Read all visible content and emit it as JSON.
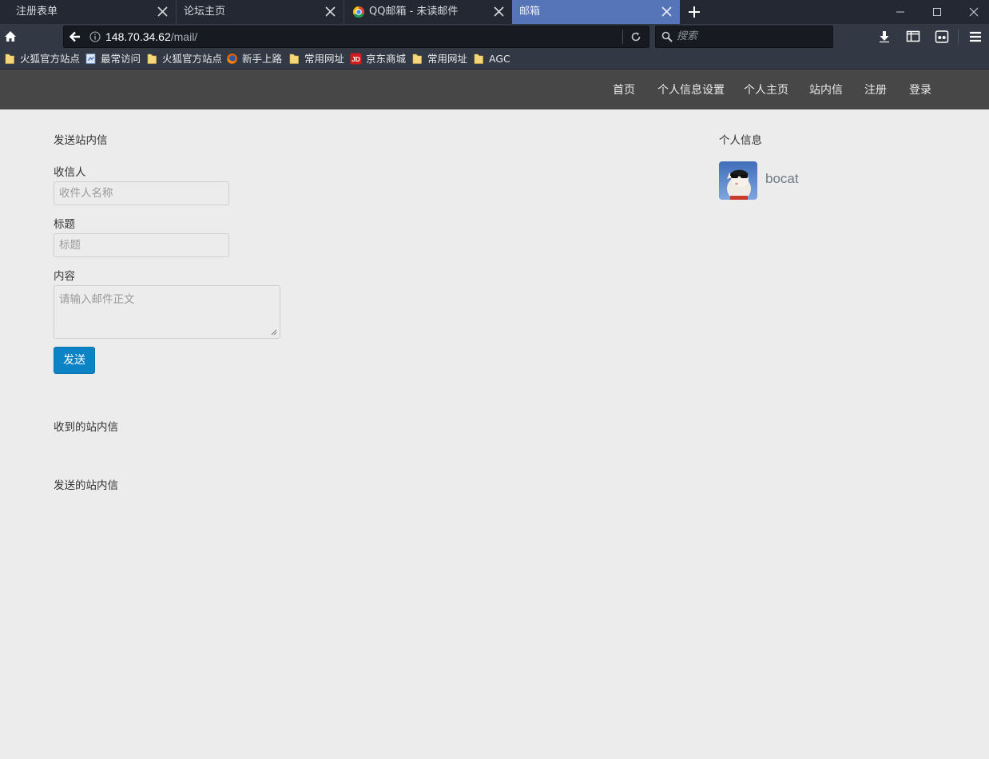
{
  "browser": {
    "tabs": [
      {
        "title": "注册表单"
      },
      {
        "title": "论坛主页"
      },
      {
        "title": "QQ邮箱 - 未读邮件"
      },
      {
        "title": "邮箱"
      }
    ],
    "url_host": "148.70.34.62",
    "url_path": "/mail/",
    "search_placeholder": "搜索",
    "bookmarks": [
      {
        "label": "火狐官方站点",
        "icon": "folder-icon"
      },
      {
        "label": "最常访问",
        "icon": "most-visited-icon"
      },
      {
        "label": "火狐官方站点",
        "icon": "folder-icon"
      },
      {
        "label": "新手上路",
        "icon": "firefox-icon"
      },
      {
        "label": "常用网址",
        "icon": "folder-icon"
      },
      {
        "label": "京东商城",
        "icon": "jd-icon"
      },
      {
        "label": "常用网址",
        "icon": "folder-icon"
      },
      {
        "label": "AGC",
        "icon": "folder-icon"
      }
    ],
    "colors": {
      "active_tab": "#5675b9",
      "chrome": "#323944",
      "tabbar": "#232833"
    }
  },
  "site": {
    "nav": [
      "首页",
      "个人信息设置",
      "个人主页",
      "站内信",
      "注册",
      "登录"
    ],
    "header_color": "#474747"
  },
  "compose": {
    "title": "发送站内信",
    "recipient_label": "收信人",
    "recipient_placeholder": "收件人名称",
    "subject_label": "标题",
    "subject_placeholder": "标题",
    "content_label": "内容",
    "content_placeholder": "请输入邮件正文",
    "send_label": "发送",
    "send_color": "#0b83c5"
  },
  "received": {
    "title": "收到的站内信"
  },
  "sent": {
    "title": "发送的站内信"
  },
  "profile": {
    "title": "个人信息",
    "username": "bocat"
  }
}
